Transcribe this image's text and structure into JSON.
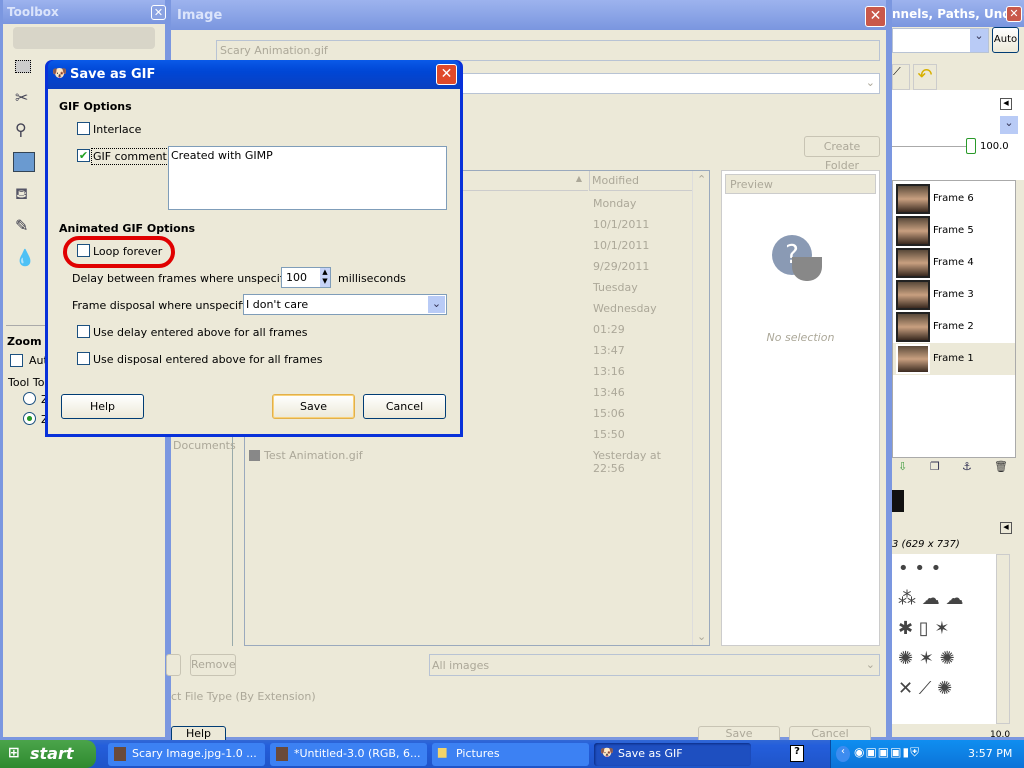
{
  "toolbox": {
    "title": "Toolbox",
    "zoom_label": "Zoom",
    "auto_label": "Auto",
    "tool_toggle_label": "Tool Tog",
    "radio1": "Z",
    "radio2": "Z"
  },
  "save_image": {
    "title": "Image",
    "filename": "Scary Animation.gif",
    "create_folder": "Create Folder",
    "column_modified": "Modified",
    "preview_label": "Preview",
    "no_selection": "No selection",
    "places_partial": "Documents",
    "files": [
      {
        "name": "",
        "modified": "Monday"
      },
      {
        "name": "",
        "modified": "10/1/2011"
      },
      {
        "name": "",
        "modified": "10/1/2011"
      },
      {
        "name": "",
        "modified": "9/29/2011"
      },
      {
        "name": "",
        "modified": "Tuesday"
      },
      {
        "name": "",
        "modified": "Wednesday"
      },
      {
        "name": "",
        "modified": "01:29"
      },
      {
        "name": "",
        "modified": "13:47"
      },
      {
        "name": "",
        "modified": "13:16"
      },
      {
        "name": "",
        "modified": "13:46"
      },
      {
        "name": "",
        "modified": "15:06"
      },
      {
        "name": "",
        "modified": "15:50"
      },
      {
        "name": "Test Animation.gif",
        "modified": "Yesterday at 22:56"
      }
    ],
    "remove": "Remove",
    "filter": "All images",
    "file_type": "ct File Type (By Extension)",
    "help": "Help",
    "save": "Save",
    "cancel": "Cancel"
  },
  "dock": {
    "title": "nnels, Paths, Undo -...",
    "auto": "Auto",
    "opacity": "100.0",
    "layers": [
      "Frame 6",
      "Frame 5",
      "Frame 4",
      "Frame 3",
      "Frame 2",
      "Frame 1"
    ],
    "brush_info": "3 (629 x 737)",
    "spacing": "10.0"
  },
  "gif_dialog": {
    "title": "Save as GIF",
    "gif_options": "GIF Options",
    "interlace": "Interlace",
    "interlace_checked": false,
    "gif_comment": "GIF comment:",
    "gif_comment_checked": true,
    "comment_text": "Created with GIMP",
    "animated_options": "Animated GIF Options",
    "loop_forever": "Loop forever",
    "loop_forever_checked": false,
    "delay_label": "Delay between frames where unspecified:",
    "delay_value": "100",
    "delay_unit": "milliseconds",
    "disposal_label": "Frame disposal where unspecified:",
    "disposal_value": "I don't care",
    "use_delay": "Use delay entered above for all frames",
    "use_disposal": "Use disposal entered above for all frames",
    "help": "Help",
    "save": "Save",
    "cancel": "Cancel",
    "highlight_color": "#e00000"
  },
  "taskbar": {
    "start": "start",
    "tasks": [
      "Scary Image.jpg-1.0 ...",
      "*Untitled-3.0 (RGB, 6...",
      "Pictures",
      "Save as GIF"
    ],
    "clock": "3:57 PM"
  }
}
